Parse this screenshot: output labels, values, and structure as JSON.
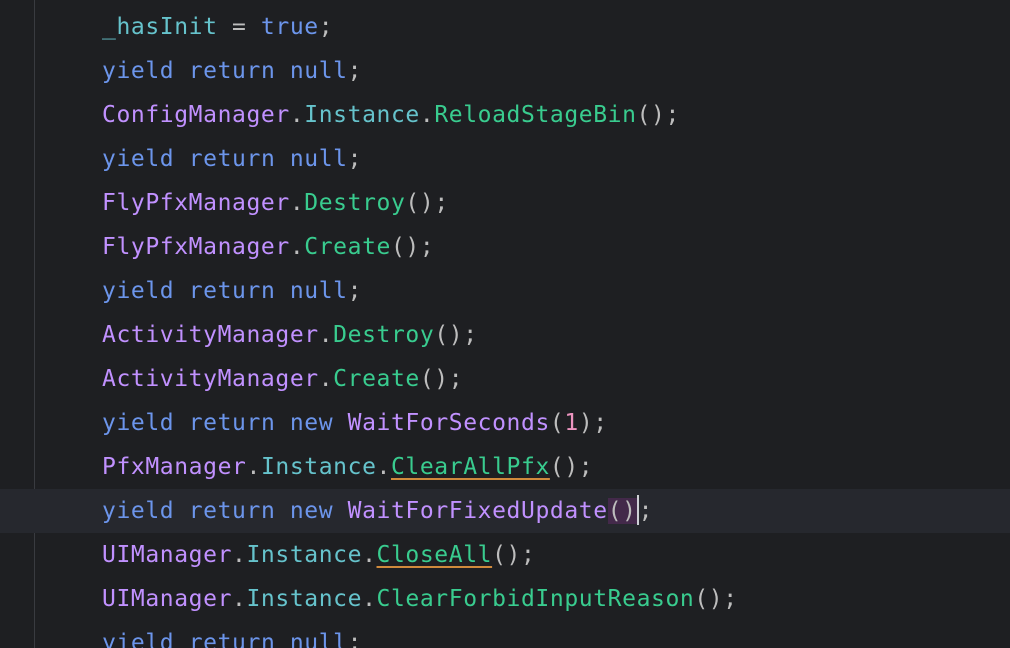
{
  "colors": {
    "background": "#1e1f22",
    "current_line": "#26282e",
    "keyword": "#6c95eb",
    "class": "#c191ff",
    "property": "#66c3cc",
    "method": "#39cc8f",
    "number": "#ed94c0",
    "warning_underline": "#d08a3c"
  },
  "code": {
    "l1": {
      "a": "_hasInit",
      "b": " = ",
      "c": "true",
      "d": ";"
    },
    "l2": {
      "a": "yield",
      "b": " ",
      "c": "return",
      "d": " ",
      "e": "null",
      "f": ";"
    },
    "l3": {
      "a": "ConfigManager",
      "b": ".",
      "c": "Instance",
      "d": ".",
      "e": "ReloadStageBin",
      "f": "();"
    },
    "l4": {
      "a": "yield",
      "b": " ",
      "c": "return",
      "d": " ",
      "e": "null",
      "f": ";"
    },
    "l5": {
      "a": "FlyPfxManager",
      "b": ".",
      "c": "Destroy",
      "d": "();"
    },
    "l6": {
      "a": "FlyPfxManager",
      "b": ".",
      "c": "Create",
      "d": "();"
    },
    "l7": {
      "a": "yield",
      "b": " ",
      "c": "return",
      "d": " ",
      "e": "null",
      "f": ";"
    },
    "l8": {
      "a": "ActivityManager",
      "b": ".",
      "c": "Destroy",
      "d": "();"
    },
    "l9": {
      "a": "ActivityManager",
      "b": ".",
      "c": "Create",
      "d": "();"
    },
    "l10": {
      "a": "yield",
      "b": " ",
      "c": "return",
      "d": " ",
      "e": "new",
      "f": " ",
      "g": "WaitForSeconds",
      "h": "(",
      "i": "1",
      "j": ");"
    },
    "l11": {
      "a": "PfxManager",
      "b": ".",
      "c": "Instance",
      "d": ".",
      "e": "ClearAllPfx",
      "f": "();"
    },
    "l12": {
      "a": "yield",
      "b": " ",
      "c": "return",
      "d": " ",
      "e": "new",
      "f": " ",
      "g": "WaitForFixedUpdate",
      "h": "()",
      "i": ";"
    },
    "l13": {
      "a": "UIManager",
      "b": ".",
      "c": "Instance",
      "d": ".",
      "e": "CloseAll",
      "f": "();"
    },
    "l14": {
      "a": "UIManager",
      "b": ".",
      "c": "Instance",
      "d": ".",
      "e": "ClearForbidInputReason",
      "f": "();"
    },
    "l15": {
      "a": "yield",
      "b": " ",
      "c": "return",
      "d": " ",
      "e": "null",
      "f": ";"
    }
  }
}
